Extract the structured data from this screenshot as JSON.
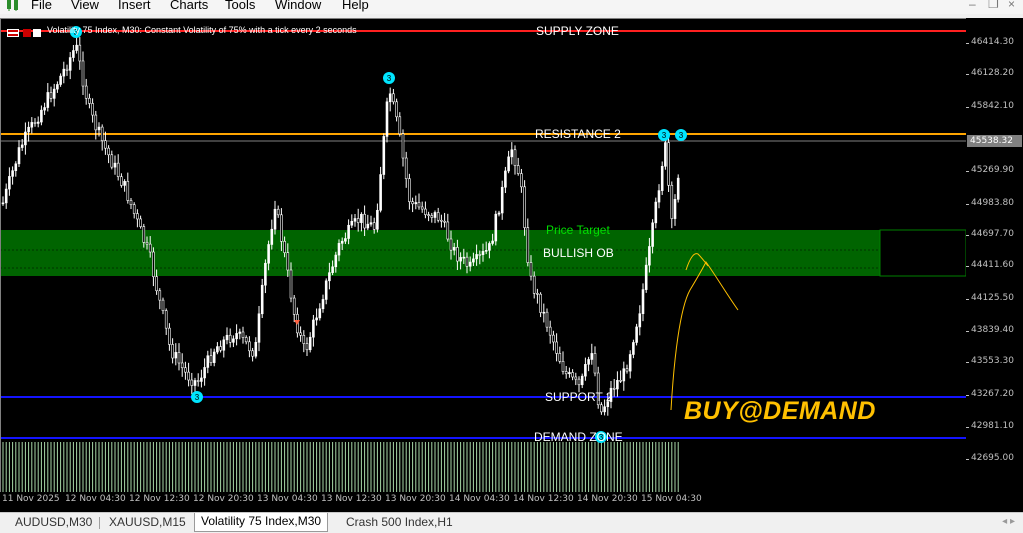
{
  "menu": {
    "items": [
      "File",
      "View",
      "Insert",
      "Charts",
      "Tools",
      "Window",
      "Help"
    ],
    "window_controls": [
      "–",
      "❐",
      "×"
    ]
  },
  "chart": {
    "title": "Volatility 75 Index, M30:  Constant Volatility of 75% with a tick every 2 seconds",
    "current_price": "45538.32",
    "price_ticks": [
      "46414.30",
      "46128.20",
      "45842.10",
      "45269.90",
      "44983.80",
      "44697.70",
      "44411.60",
      "44125.50",
      "43839.40",
      "43553.30",
      "43267.20",
      "42981.10",
      "42695.00"
    ],
    "time_ticks": [
      "11 Nov 2025",
      "12 Nov 04:30",
      "12 Nov 12:30",
      "12 Nov 20:30",
      "13 Nov 04:30",
      "13 Nov 12:30",
      "13 Nov 20:30",
      "14 Nov 04:30",
      "14 Nov 12:30",
      "14 Nov 20:30",
      "15 Nov 04:30"
    ],
    "labels": {
      "supply_zone": "SUPPLY ZONE",
      "resistance": "RESISTANCE 2",
      "price_target": "Price Target",
      "bullish_ob": "BULLISH OB",
      "support": "SUPPORT 2",
      "demand_zone": "DEMAND ZONE",
      "buy": "BUY@DEMAND"
    },
    "colors": {
      "background": "#000000",
      "candles": "#ffffff",
      "supply_line": "#ff2020",
      "resistance_line": "#ffa500",
      "bullish_ob_fill": "#006400",
      "price_target_text": "#00dd00",
      "support_line": "#1414ff",
      "fractal_marker": "#00e5ff",
      "projection": "#ffc000",
      "volume": "#a8d8a8"
    },
    "marker_text": "3"
  },
  "tabs": {
    "items": [
      "AUDUSD,M30",
      "XAUUSD,M15",
      "Volatility 75 Index,M30",
      "Crash 500 Index,H1"
    ],
    "active_index": 2
  }
}
